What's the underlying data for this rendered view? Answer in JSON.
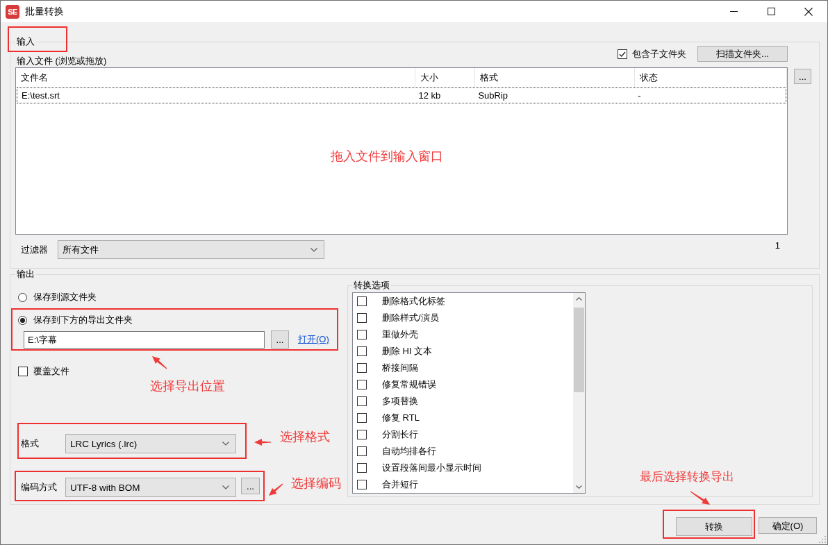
{
  "window": {
    "logo": "SE",
    "title": "批量转换"
  },
  "input": {
    "legend": "输入",
    "files_label": "输入文件 (浏览或拖放)",
    "include_subfolders": {
      "label": "包含子文件夹",
      "checked": true
    },
    "scan_button": "扫描文件夹...",
    "more_button": "...",
    "table": {
      "columns": [
        "文件名",
        "大小",
        "格式",
        "状态"
      ],
      "rows": [
        {
          "cells": [
            "E:\\test.srt",
            "12 kb",
            "SubRip",
            "-"
          ],
          "focused": true
        }
      ]
    },
    "filter": {
      "label": "过滤器",
      "value": "所有文件"
    },
    "count": "1"
  },
  "output": {
    "legend": "输出",
    "destinations": [
      {
        "label": "保存到源文件夹",
        "selected": false
      },
      {
        "label": "保存到下方的导出文件夹",
        "selected": true
      }
    ],
    "folder": {
      "value": "E:\\字幕",
      "browse_button": "...",
      "open_link": "打开(O)"
    },
    "overwrite": {
      "label": "覆盖文件",
      "checked": false
    },
    "format": {
      "label": "格式",
      "value": "LRC Lyrics (.lrc)"
    },
    "encoding": {
      "label": "编码方式",
      "value": "UTF-8 with BOM",
      "more_button": "..."
    },
    "options": {
      "legend": "转换选项",
      "items": [
        {
          "label": "删除格式化标签",
          "checked": false
        },
        {
          "label": "删除样式/演员",
          "checked": false
        },
        {
          "label": "重做外壳",
          "checked": false
        },
        {
          "label": "删除 HI 文本",
          "checked": false
        },
        {
          "label": "桥接间隔",
          "checked": false
        },
        {
          "label": "修复常规错误",
          "checked": false
        },
        {
          "label": "多项替换",
          "checked": false
        },
        {
          "label": "修复 RTL",
          "checked": false
        },
        {
          "label": "分割长行",
          "checked": false
        },
        {
          "label": "自动均排各行",
          "checked": false
        },
        {
          "label": "设置段落间最小显示时间",
          "checked": false
        },
        {
          "label": "合并短行",
          "checked": false
        }
      ]
    }
  },
  "convert_button": "转换",
  "ok_button": "确定(O)",
  "annotations": [
    {
      "text": "拖入文件到输入窗口"
    },
    {
      "text": "选择导出位置"
    },
    {
      "text": "选择格式"
    },
    {
      "text": "选择编码"
    },
    {
      "text": "最后选择转换导出"
    }
  ]
}
